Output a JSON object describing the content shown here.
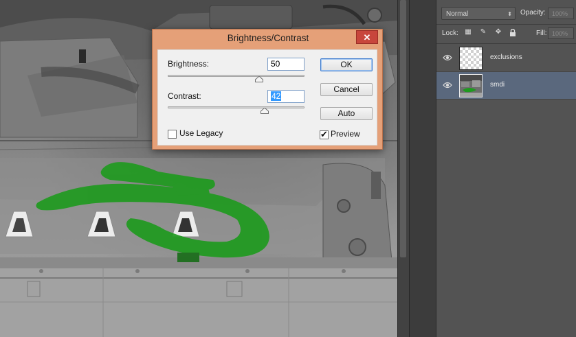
{
  "dialog": {
    "title": "Brightness/Contrast",
    "close_glyph": "✕",
    "brightness": {
      "label": "Brightness:",
      "value": "50",
      "slider_fraction": 0.67
    },
    "contrast": {
      "label": "Contrast:",
      "value": "42",
      "slider_fraction": 0.71
    },
    "buttons": {
      "ok": "OK",
      "cancel": "Cancel",
      "auto": "Auto"
    },
    "use_legacy": {
      "label": "Use Legacy",
      "checked": false
    },
    "preview": {
      "label": "Preview",
      "checked": true,
      "check_glyph": "✔"
    }
  },
  "layers_panel": {
    "blend_mode": "Normal",
    "opacity_label": "Opacity:",
    "opacity_value": "100%",
    "lock_label": "Lock:",
    "fill_label": "Fill:",
    "fill_value": "100%",
    "layers": [
      {
        "name": "exclusions",
        "visible": true,
        "selected": false,
        "thumbnail": "transparent-checker"
      },
      {
        "name": "smdi",
        "visible": true,
        "selected": true,
        "thumbnail": "texture-with-green-mask"
      }
    ]
  },
  "colors": {
    "mask_green": "#1f9a1f",
    "dialog_frame": "#e5a078",
    "close_button": "#c8463c",
    "selected_layer": "#5a687d"
  }
}
